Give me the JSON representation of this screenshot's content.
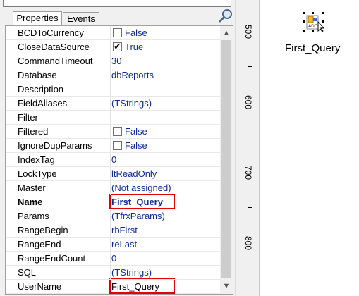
{
  "inspector": {
    "tabs": [
      "Properties",
      "Events"
    ],
    "properties": [
      {
        "name": "BCDToCurrency",
        "value": "False",
        "checkbox": true,
        "checked": false
      },
      {
        "name": "CloseDataSource",
        "value": "True",
        "checkbox": true,
        "checked": true
      },
      {
        "name": "CommandTimeout",
        "value": "30"
      },
      {
        "name": "Database",
        "value": "dbReports"
      },
      {
        "name": "Description",
        "value": ""
      },
      {
        "name": "FieldAliases",
        "value": "(TStrings)"
      },
      {
        "name": "Filter",
        "value": ""
      },
      {
        "name": "Filtered",
        "value": "False",
        "checkbox": true,
        "checked": false
      },
      {
        "name": "IgnoreDupParams",
        "value": "False",
        "checkbox": true,
        "checked": false
      },
      {
        "name": "IndexTag",
        "value": "0"
      },
      {
        "name": "LockType",
        "value": "ltReadOnly"
      },
      {
        "name": "Master",
        "value": "(Not assigned)"
      },
      {
        "name": "Name",
        "value": "First_Query",
        "bold": true,
        "highlight": true
      },
      {
        "name": "Params",
        "value": "(TfrxParams)"
      },
      {
        "name": "RangeBegin",
        "value": "rbFirst"
      },
      {
        "name": "RangeEnd",
        "value": "reLast"
      },
      {
        "name": "RangeEndCount",
        "value": "0"
      },
      {
        "name": "SQL",
        "value": "(TStrings)"
      },
      {
        "name": "UserName",
        "value": "First_Query",
        "plain": true,
        "highlight": true
      }
    ]
  },
  "ruler": {
    "labels": [
      "500",
      "600",
      "700",
      "800"
    ]
  },
  "design": {
    "component_label": "First_Query",
    "component_badge": "ADO"
  },
  "colors": {
    "value_text": "#0f2c96",
    "highlight_border": "#e10000"
  }
}
